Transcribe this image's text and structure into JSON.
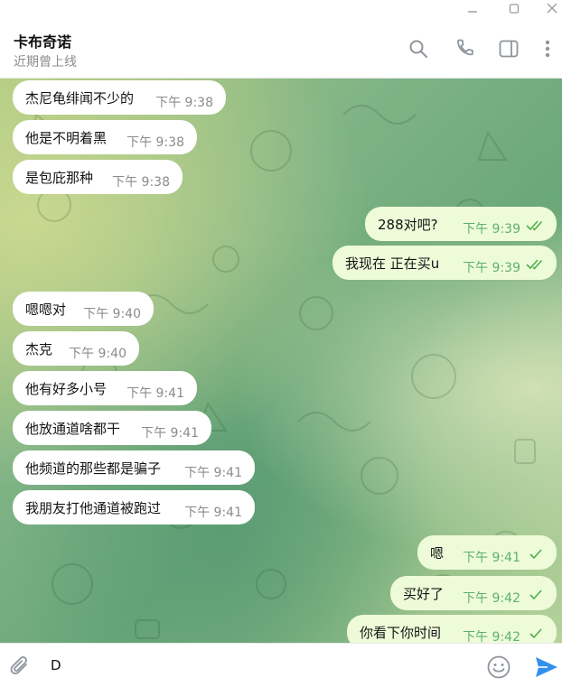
{
  "header": {
    "name": "卡布奇诺",
    "status": "近期曾上线"
  },
  "messages": [
    {
      "dir": "in",
      "text": "杰尼龟绯闻不少的",
      "time": "下午 9:38"
    },
    {
      "dir": "in",
      "text": "他是不明着黑",
      "time": "下午 9:38"
    },
    {
      "dir": "in",
      "text": "是包庇那种",
      "time": "下午 9:38"
    },
    {
      "dir": "out",
      "text": "288对吧?",
      "time": "下午 9:39",
      "read": true
    },
    {
      "dir": "out",
      "text": "我现在 正在买u",
      "time": "下午 9:39",
      "read": true
    },
    {
      "dir": "in",
      "text": "嗯嗯对",
      "time": "下午 9:40"
    },
    {
      "dir": "in",
      "text": "杰克",
      "time": "下午 9:40"
    },
    {
      "dir": "in",
      "text": "他有好多小号",
      "time": "下午 9:41"
    },
    {
      "dir": "in",
      "text": "他放通道啥都干",
      "time": "下午 9:41"
    },
    {
      "dir": "in",
      "text": "他频道的那些都是骗子",
      "time": "下午 9:41"
    },
    {
      "dir": "in",
      "text": "我朋友打他通道被跑过",
      "time": "下午 9:41"
    },
    {
      "dir": "out",
      "text": "嗯",
      "time": "下午 9:41",
      "read": false
    },
    {
      "dir": "out",
      "text": "买好了",
      "time": "下午 9:42",
      "read": false
    },
    {
      "dir": "out",
      "text": "你看下你时间",
      "time": "下午 9:42",
      "read": false
    }
  ],
  "composer": {
    "value": "D"
  },
  "icons": {
    "search": "search-icon",
    "call": "phone-icon",
    "sidebar": "sidebar-toggle-icon",
    "more": "more-vertical-icon",
    "attach": "paperclip-icon",
    "emoji": "emoji-icon",
    "send": "send-icon"
  },
  "colors": {
    "incoming_bubble": "#ffffff",
    "outgoing_bubble": "#eefbd9",
    "outgoing_time": "#5fb06b",
    "send_accent": "#3390ec"
  }
}
